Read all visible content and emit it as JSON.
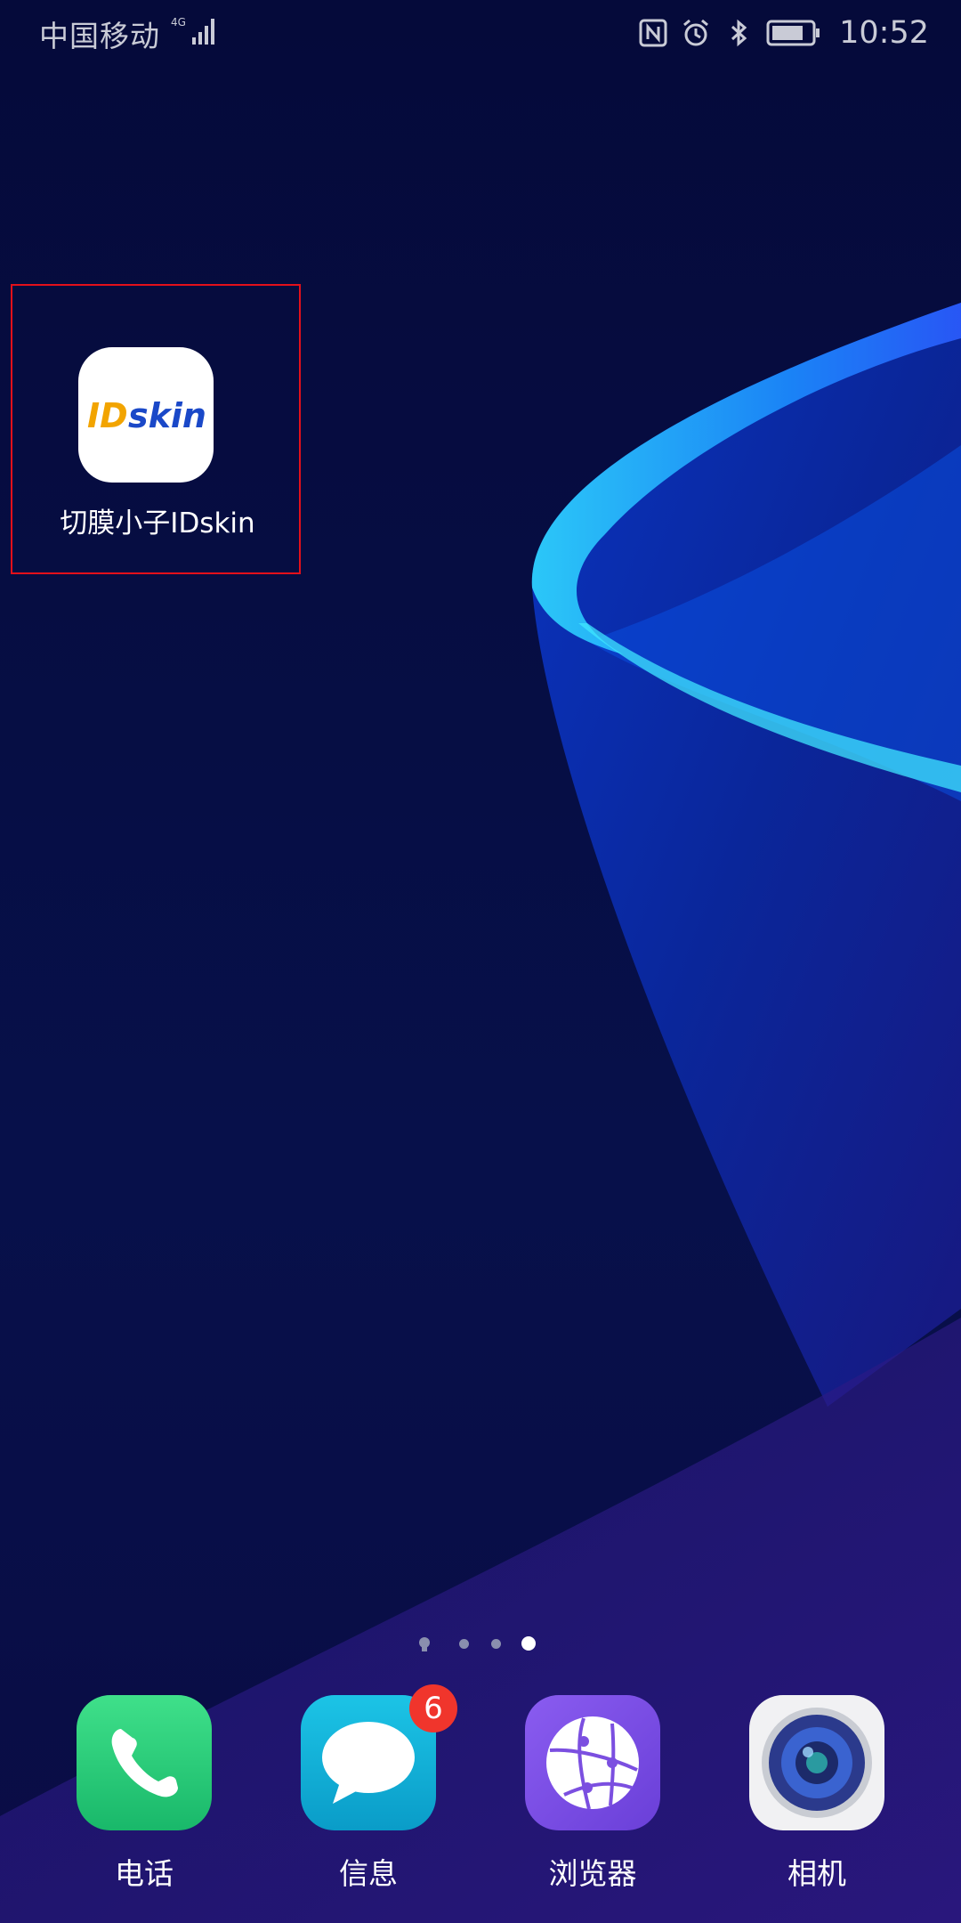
{
  "status_bar": {
    "carrier": "中国移动",
    "network_label": "4G",
    "time": "10:52",
    "icons": [
      "nfc-icon",
      "alarm-icon",
      "bluetooth-icon",
      "battery-icon"
    ]
  },
  "desktop": {
    "apps": [
      {
        "label": "切膜小子IDskin",
        "icon": "idskin-logo",
        "logo_text": "IDskin",
        "highlighted": true
      }
    ]
  },
  "page_indicator": {
    "pages": 4,
    "current_page": 4,
    "first_page_icon": "lightbulb-icon"
  },
  "dock": {
    "apps": [
      {
        "label": "电话",
        "icon": "phone-icon"
      },
      {
        "label": "信息",
        "icon": "message-icon",
        "badge": "6"
      },
      {
        "label": "浏览器",
        "icon": "browser-icon"
      },
      {
        "label": "相机",
        "icon": "camera-icon"
      }
    ]
  },
  "colors": {
    "wallpaper_base": "#050b3e",
    "highlight_border": "#e3101a",
    "badge": "#f0352c",
    "phone": "#2fd07a",
    "message": "#12b4d8",
    "browser": "#7b4fe0"
  }
}
